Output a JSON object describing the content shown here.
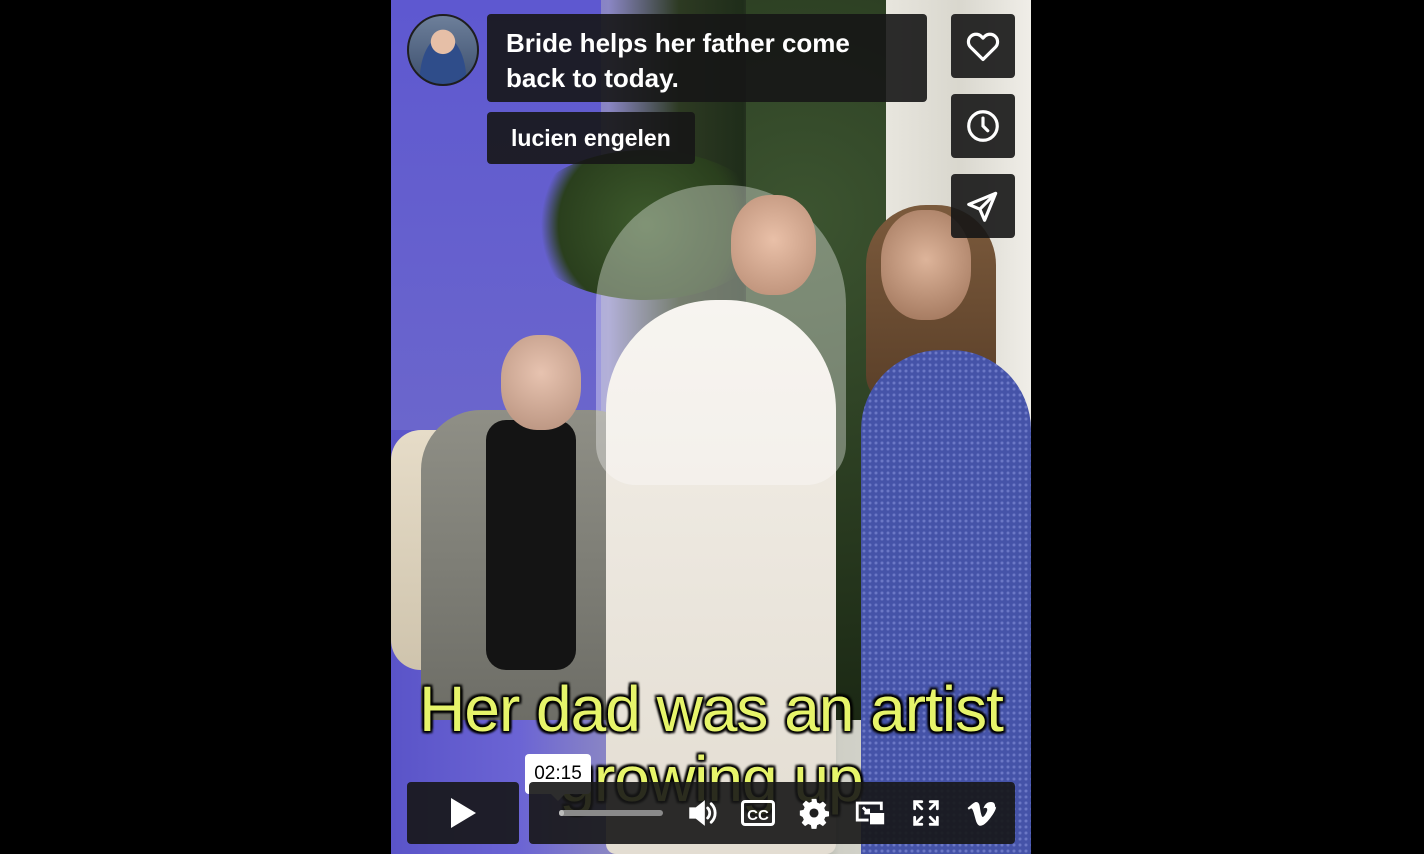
{
  "video": {
    "title": "Bride helps her father come back to today.",
    "author": "lucien engelen",
    "caption_line1": "Her dad was an artist",
    "caption_line2": "growing up",
    "progress_fraction": 0.05
  },
  "side_actions": {
    "like_icon": "heart-icon",
    "watch_later_icon": "clock-icon",
    "share_icon": "paper-plane-icon"
  },
  "controls": {
    "time_tooltip": "02:15",
    "cc_label": "CC",
    "icons": [
      "play-icon",
      "volume-icon",
      "cc-icon",
      "gear-icon",
      "picture-in-picture-icon",
      "fullscreen-icon",
      "vimeo-logo-icon"
    ]
  },
  "colors": {
    "caption": "#e6f46a",
    "panel": "#161616"
  }
}
